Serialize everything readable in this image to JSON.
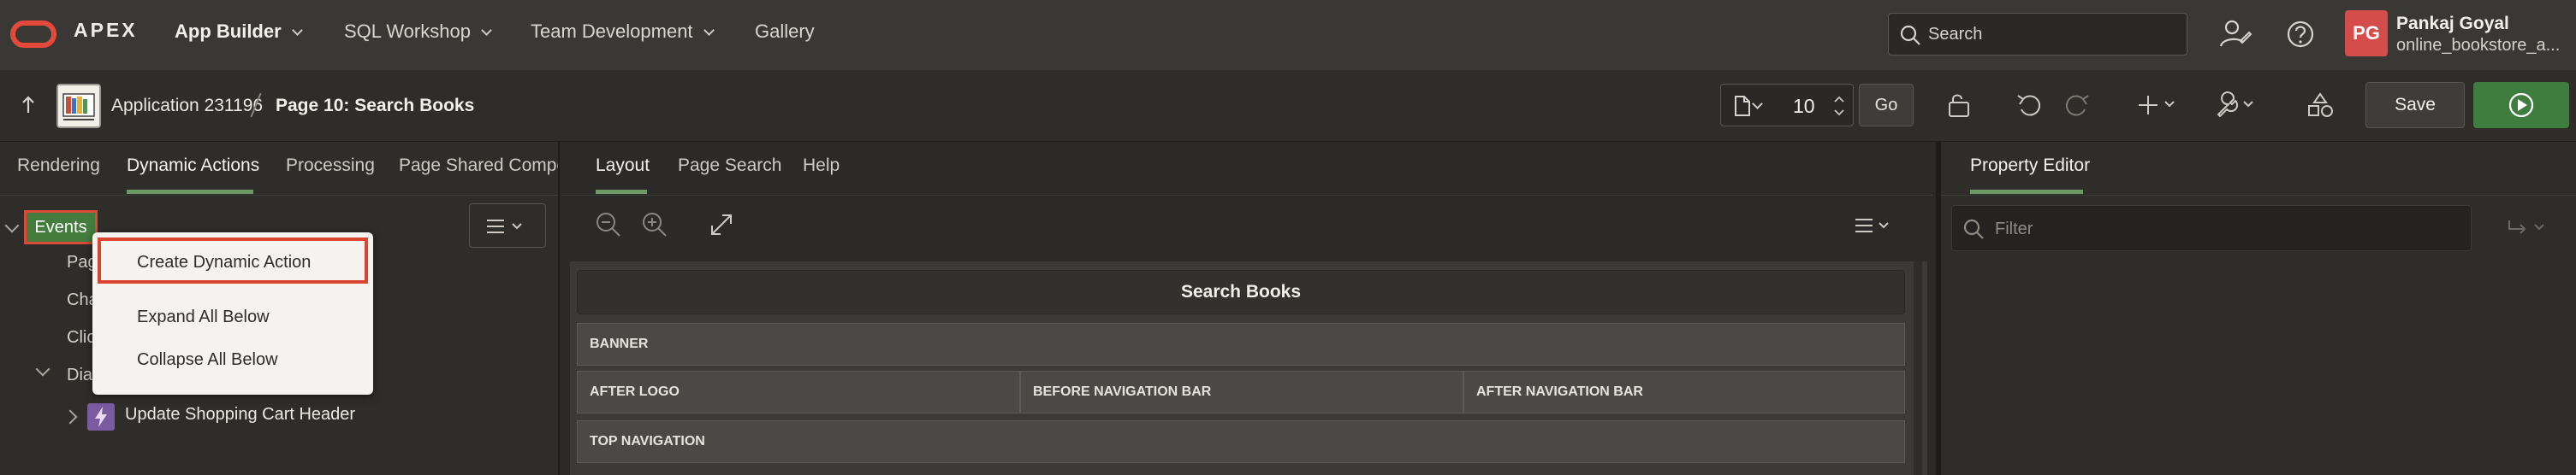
{
  "header": {
    "brand": "APEX",
    "nav": [
      {
        "label": "App Builder",
        "has_caret": true
      },
      {
        "label": "SQL Workshop",
        "has_caret": true
      },
      {
        "label": "Team Development",
        "has_caret": true
      },
      {
        "label": "Gallery",
        "has_caret": false
      }
    ],
    "search_placeholder": "Search",
    "avatar_initials": "PG",
    "user_name": "Pankaj Goyal",
    "user_workspace": "online_bookstore_a..."
  },
  "toolbar": {
    "app_crumb": "Application 231196",
    "page_crumb": "Page 10: Search Books",
    "page_number": "10",
    "go_label": "Go",
    "save_label": "Save"
  },
  "left_panel": {
    "tabs": [
      "Rendering",
      "Dynamic Actions",
      "Processing",
      "Page Shared Compon"
    ],
    "active_tab": "Dynamic Actions",
    "tree": {
      "events_label": "Events",
      "partial_items": [
        "Pag",
        "Cha",
        "Clic",
        "Dia"
      ],
      "action_label": "Update Shopping Cart Header"
    },
    "context_menu": [
      {
        "label": "Create Dynamic Action",
        "highlighted": true
      },
      {
        "label": "Expand All Below",
        "highlighted": false
      },
      {
        "label": "Collapse All Below",
        "highlighted": false
      }
    ]
  },
  "middle_panel": {
    "tabs": [
      "Layout",
      "Page Search",
      "Help"
    ],
    "active_tab": "Layout",
    "page_title": "Search Books",
    "regions": [
      "BANNER",
      "AFTER LOGO",
      "BEFORE NAVIGATION BAR",
      "AFTER NAVIGATION BAR",
      "TOP NAVIGATION"
    ]
  },
  "right_panel": {
    "tab": "Property Editor",
    "filter_placeholder": "Filter"
  },
  "colors": {
    "accent_green": "#6b9a66",
    "highlight_red": "#d9452f",
    "brand_red": "#e34a3a"
  }
}
